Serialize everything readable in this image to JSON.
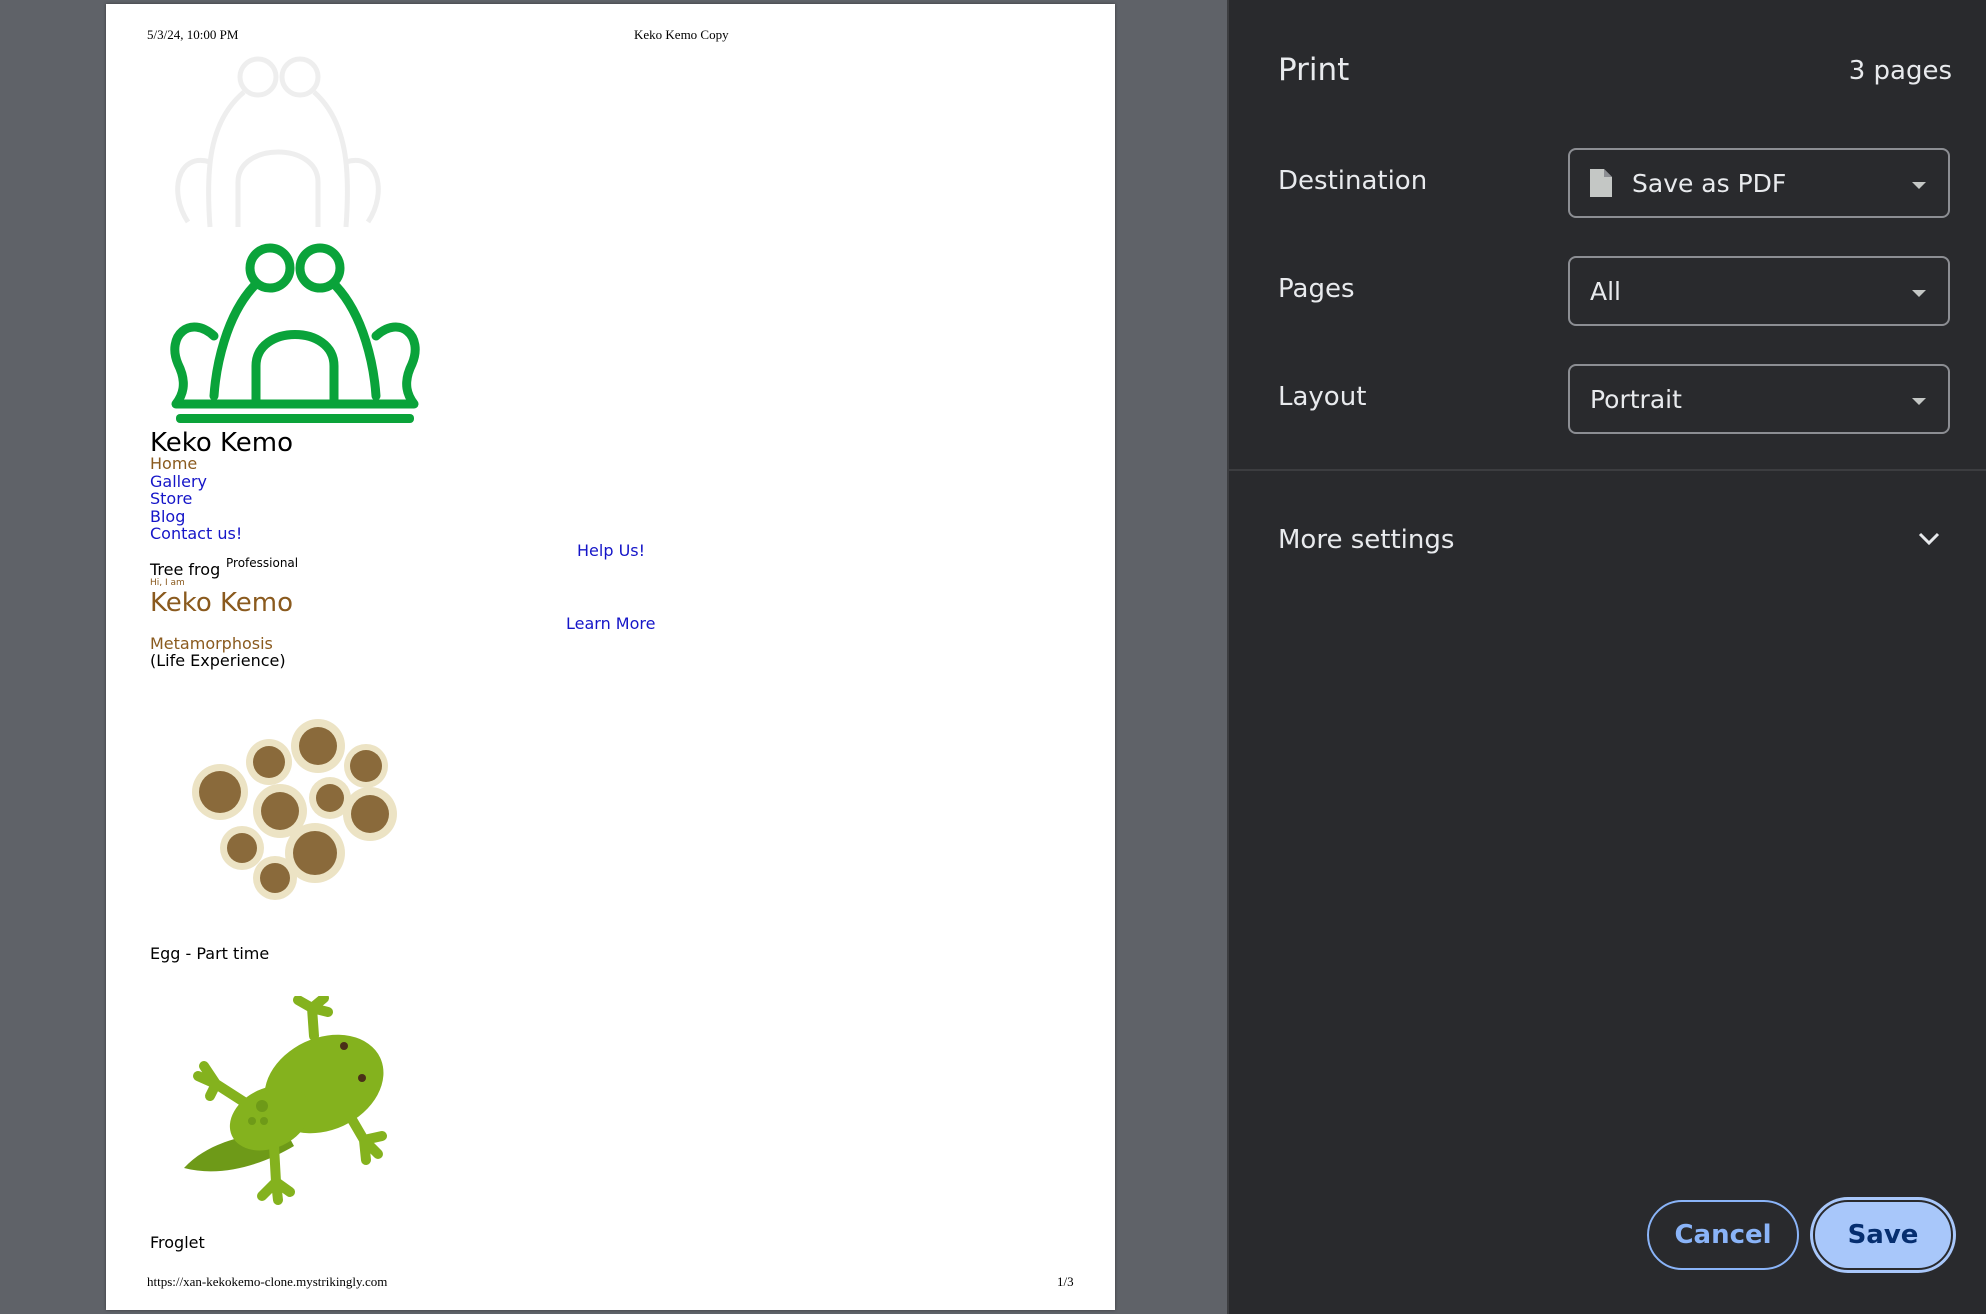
{
  "preview": {
    "header_date": "5/3/24, 10:00 PM",
    "header_title": "Keko Kemo Copy",
    "footer_url": "https://xan-kekokemo-clone.mystrikingly.com",
    "footer_page": "1/3",
    "site_title": "Keko Kemo",
    "nav": [
      "Home",
      "Gallery",
      "Store",
      "Blog",
      "Contact us!"
    ],
    "help_us": "Help Us!",
    "learn_more": "Learn More",
    "tree_frog": "Tree frog",
    "professional": "Professional",
    "hi_i_am": "Hi, I am",
    "hero_name": "Keko Kemo",
    "metamorphosis": "Metamorphosis",
    "life_experience": "(Life Experience)",
    "egg_caption": "Egg - Part time",
    "froglet_caption": "Froglet"
  },
  "panel": {
    "title": "Print",
    "page_count": "3 pages",
    "destination_label": "Destination",
    "destination_value": "Save as PDF",
    "pages_label": "Pages",
    "pages_value": "All",
    "layout_label": "Layout",
    "layout_value": "Portrait",
    "more_settings": "More settings",
    "cancel": "Cancel",
    "save": "Save"
  },
  "colors": {
    "frog_green": "#0aa33a",
    "link_blue": "#1515c8",
    "brown": "#8a5a1e",
    "save_bg": "#a8c7fa",
    "cancel_text": "#8ab4f8"
  }
}
